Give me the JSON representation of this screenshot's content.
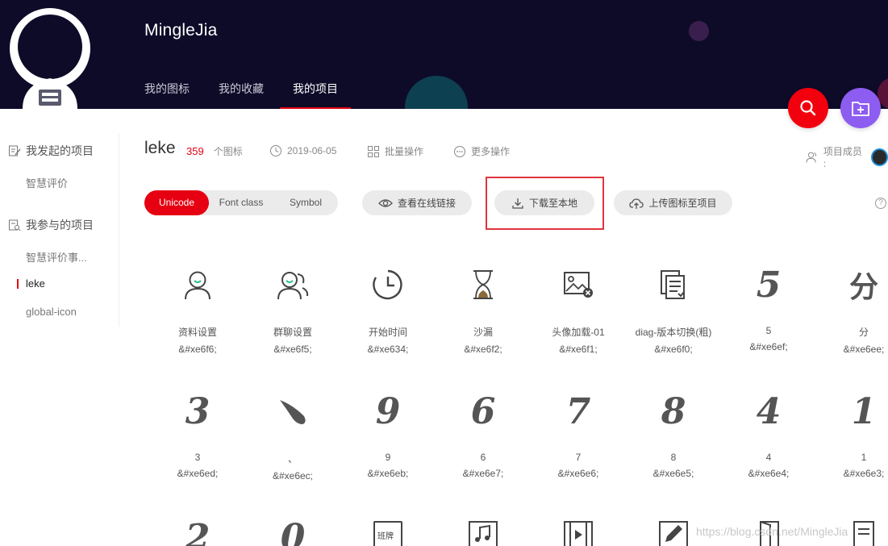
{
  "header": {
    "brand": "MingleJia",
    "nav": [
      "我的图标",
      "我的收藏",
      "我的项目"
    ]
  },
  "sidebar": {
    "group1": "我发起的项目",
    "group1_items": [
      "智慧评价"
    ],
    "group2": "我参与的项目",
    "group2_items": [
      "智慧评价事...",
      "leke",
      "global-icon"
    ]
  },
  "project": {
    "name": "leke",
    "icon_count": "359",
    "icon_count_label": "个图标",
    "date": "2019-06-05",
    "batch": "批量操作",
    "more": "更多操作",
    "members": "项目成员 :"
  },
  "toolbar": {
    "tabs": [
      "Unicode",
      "Font class",
      "Symbol"
    ],
    "view_link": "查看在线链接",
    "download": "下载至本地",
    "upload": "上传图标至项目",
    "help": "?"
  },
  "icons_row1": [
    {
      "name": "资料设置",
      "code": "&#xe6f6;",
      "icon": "user-smile-icon"
    },
    {
      "name": "群聊设置",
      "code": "&#xe6f5;",
      "icon": "group-chat-icon"
    },
    {
      "name": "开始时间",
      "code": "&#xe634;",
      "icon": "clock-icon"
    },
    {
      "name": "沙漏",
      "code": "&#xe6f2;",
      "icon": "hourglass-icon"
    },
    {
      "name": "头像加载-01",
      "code": "&#xe6f1;",
      "icon": "image-close-icon"
    },
    {
      "name": "diag-版本切换(粗)",
      "code": "&#xe6f0;",
      "icon": "document-switch-icon"
    },
    {
      "name": "5",
      "code": "&#xe6ef;",
      "glyph": "5"
    },
    {
      "name": "分",
      "code": "&#xe6ee;",
      "glyph": "分"
    }
  ],
  "icons_row2": [
    {
      "name": "3",
      "code": "&#xe6ed;",
      "glyph": "3"
    },
    {
      "name": "、",
      "code": "&#xe6ec;",
      "glyph": "、"
    },
    {
      "name": "9",
      "code": "&#xe6eb;",
      "glyph": "9"
    },
    {
      "name": "6",
      "code": "&#xe6e7;",
      "glyph": "6"
    },
    {
      "name": "7",
      "code": "&#xe6e6;",
      "glyph": "7"
    },
    {
      "name": "8",
      "code": "&#xe6e5;",
      "glyph": "8"
    },
    {
      "name": "4",
      "code": "&#xe6e4;",
      "glyph": "4"
    },
    {
      "name": "1",
      "code": "&#xe6e3;",
      "glyph": "1"
    }
  ],
  "icons_row3": [
    {
      "glyph": "2"
    },
    {
      "glyph": "0"
    },
    {
      "label": "班牌"
    },
    {
      "icon": "music-note-icon"
    },
    {
      "icon": "video-icon"
    },
    {
      "icon": "edit-doc-icon"
    },
    {
      "icon": "door-icon"
    },
    {
      "icon": "list-doc-icon"
    }
  ],
  "watermark": "https://blog.csdn.net/MingleJia"
}
